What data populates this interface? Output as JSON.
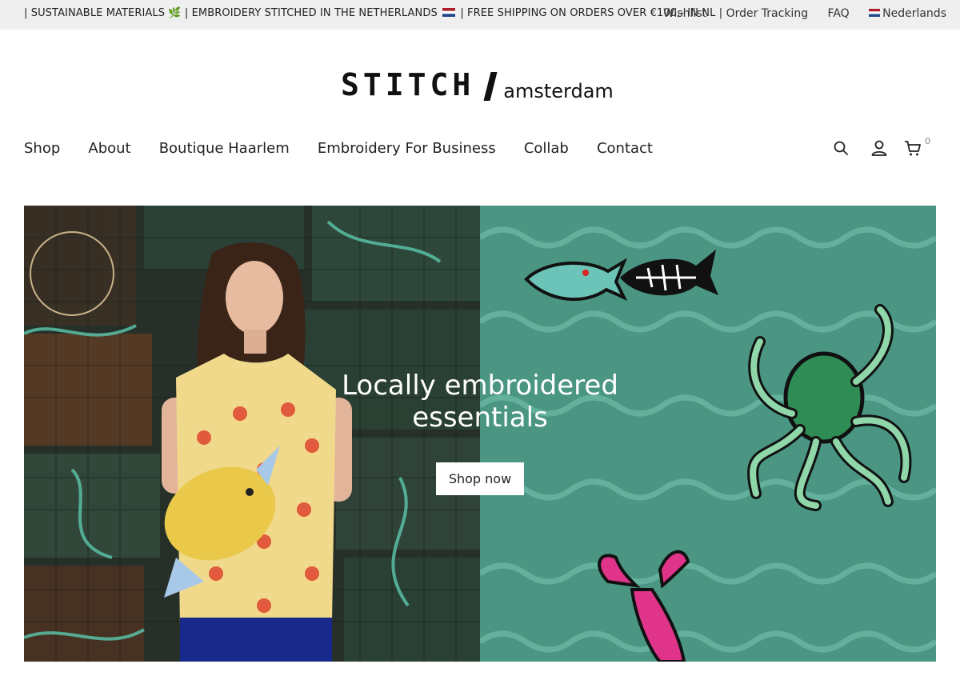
{
  "topbar": {
    "marquee_part1": "| SUSTAINABLE MATERIALS",
    "marquee_part2": "| EMBROIDERY STITCHED IN THE NETHERLANDS",
    "marquee_part3": "| FREE SHIPPING ON ORDERS OVER €100,- IN NL |",
    "links": {
      "wishlist": "Wishlist",
      "order_tracking": "Order Tracking",
      "faq": "FAQ",
      "language": "Nederlands"
    }
  },
  "logo": {
    "brand": "STITCH",
    "sub": "amsterdam"
  },
  "nav": {
    "items": [
      {
        "label": "Shop"
      },
      {
        "label": "About"
      },
      {
        "label": "Boutique Haarlem"
      },
      {
        "label": "Embroidery For Business"
      },
      {
        "label": "Collab"
      },
      {
        "label": "Contact"
      }
    ],
    "icons": [
      "search-icon",
      "account-icon",
      "cart-icon"
    ],
    "cart_count": "0"
  },
  "hero": {
    "title_line1": "Locally embroidered",
    "title_line2": "essentials",
    "button_label": "Shop now"
  },
  "colors": {
    "teal": "#4a9683",
    "topbar_bg": "#efefef"
  }
}
